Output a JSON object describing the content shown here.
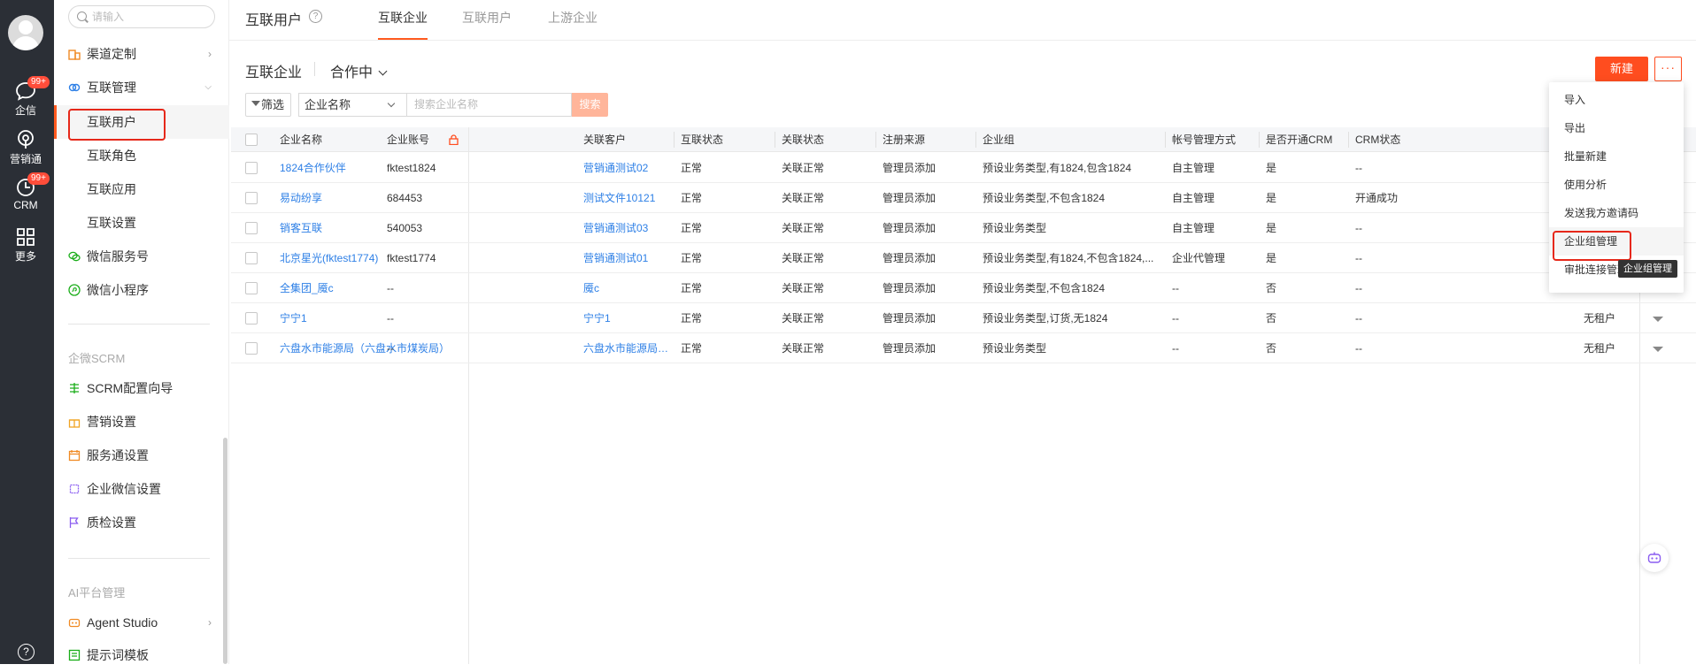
{
  "rail": {
    "items": [
      {
        "label": "企信",
        "icon": "chat-icon",
        "badge": "99+"
      },
      {
        "label": "营销通",
        "icon": "broadcast-icon"
      },
      {
        "label": "CRM",
        "icon": "clock-icon",
        "badge": "99+"
      },
      {
        "label": "更多",
        "icon": "grid-icon"
      }
    ],
    "help": "?"
  },
  "sidebar": {
    "search_placeholder": "请输入",
    "items": [
      {
        "label": "渠道定制",
        "icon": "building-icon"
      },
      {
        "label": "互联管理",
        "icon": "link-rings-icon"
      },
      {
        "label": "微信服务号",
        "icon": "wechat-icon"
      },
      {
        "label": "微信小程序",
        "icon": "miniprogram-icon"
      }
    ],
    "sub_items": [
      "互联用户",
      "互联角色",
      "互联应用",
      "互联设置"
    ],
    "scrm_title": "企微SCRM",
    "scrm_items": [
      {
        "label": "SCRM配置向导",
        "icon": "guide-icon"
      },
      {
        "label": "营销设置",
        "icon": "gift-icon"
      },
      {
        "label": "服务通设置",
        "icon": "calendar-icon"
      },
      {
        "label": "企业微信设置",
        "icon": "chip-icon"
      },
      {
        "label": "质检设置",
        "icon": "flag-icon"
      }
    ],
    "ai_title": "AI平台管理",
    "ai_items": [
      {
        "label": "Agent Studio",
        "icon": "robot-icon"
      },
      {
        "label": "提示词模板",
        "icon": "template-icon"
      }
    ]
  },
  "header": {
    "title": "互联用户",
    "tabs": [
      "互联企业",
      "互联用户",
      "上游企业"
    ]
  },
  "toolbar": {
    "section_title": "互联企业",
    "state": "合作中",
    "new_label": "新建",
    "more_label": "···",
    "filter_label": "筛选",
    "field_select": "企业名称",
    "search_placeholder": "搜索企业名称",
    "search_label": "搜索"
  },
  "table": {
    "columns": [
      "企业名称",
      "企业账号",
      "关联客户",
      "互联状态",
      "关联状态",
      "注册来源",
      "企业组",
      "帐号管理方式",
      "是否开通CRM",
      "CRM状态"
    ],
    "rows": [
      [
        "1824合作伙伴",
        "fktest1824",
        "营销通测试02",
        "正常",
        "关联正常",
        "管理员添加",
        "预设业务类型,有1824,包含1824",
        "自主管理",
        "是",
        "--",
        ""
      ],
      [
        "易动纷享",
        "684453",
        "测试文件10121",
        "正常",
        "关联正常",
        "管理员添加",
        "预设业务类型,不包含1824",
        "自主管理",
        "是",
        "开通成功",
        ""
      ],
      [
        "销客互联",
        "540053",
        "营销通测试03",
        "正常",
        "关联正常",
        "管理员添加",
        "预设业务类型",
        "自主管理",
        "是",
        "--",
        ""
      ],
      [
        "北京星光(fktest1774)",
        "fktest1774",
        "营销通测试01",
        "正常",
        "关联正常",
        "管理员添加",
        "预设业务类型,有1824,不包含1824,...",
        "企业代管理",
        "是",
        "--",
        ""
      ],
      [
        "全集团_魇c",
        "--",
        "魇c",
        "正常",
        "关联正常",
        "管理员添加",
        "预设业务类型,不包含1824",
        "--",
        "否",
        "--",
        ""
      ],
      [
        "宁宁1",
        "--",
        "宁宁1",
        "正常",
        "关联正常",
        "管理员添加",
        "预设业务类型,订货,无1824",
        "--",
        "否",
        "--",
        "无租户"
      ],
      [
        "六盘水市能源局（六盘水市煤炭局）",
        "--",
        "六盘水市能源局（六盘水...",
        "正常",
        "关联正常",
        "管理员添加",
        "预设业务类型",
        "--",
        "否",
        "--",
        "无租户"
      ]
    ]
  },
  "menu": {
    "items": [
      "导入",
      "导出",
      "批量新建",
      "使用分析",
      "发送我方邀请码",
      "企业组管理",
      "审批连接管理"
    ],
    "tooltip": "企业组管理"
  },
  "colors": {
    "accent": "#ff4d1f",
    "link": "#2d7fe6",
    "highlight_box": "#e6281a"
  }
}
